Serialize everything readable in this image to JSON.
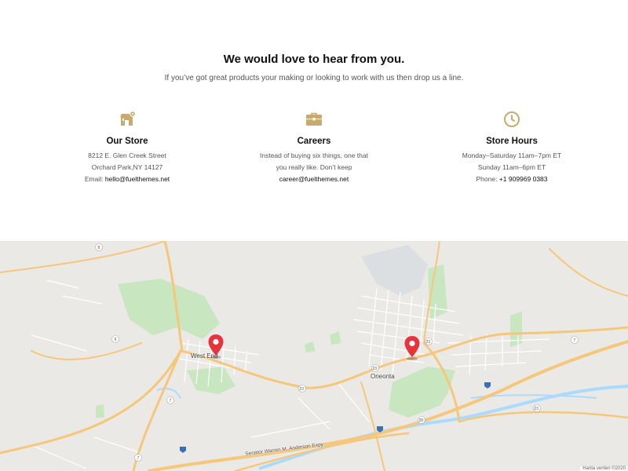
{
  "contact": {
    "heading": "We would love to hear from you.",
    "subheading": "If you’ve got great products your making or looking to work with us then drop us a line.",
    "columns": {
      "store": {
        "icon": "store-icon",
        "title": "Our Store",
        "address_line1": "8212 E. Glen Creek Street",
        "address_line2": "Orchard Park,NY 14127",
        "email_label": "Email:",
        "email": "hello@fuelthemes.net"
      },
      "careers": {
        "icon": "briefcase-icon",
        "title": "Careers",
        "text_line1": "Instead of buying six things, one that",
        "text_line2": "you really like. Don’t keep",
        "email": "career@fuelthemes.net"
      },
      "hours": {
        "icon": "clock-icon",
        "title": "Store Hours",
        "line1": "Monday–Saturday 11am–7pm ET",
        "line2": "Sunday 11am–6pm ET",
        "phone_label": "Phone:",
        "phone": "+1 909969 0383"
      }
    }
  },
  "map": {
    "places": {
      "west_end": "West End",
      "oneonta": "Oneonta"
    },
    "road_name": "Senator Warren M. Anderson Expy",
    "attribution": "Harita verileri ©2020"
  },
  "colors": {
    "accent": "#c9a96e",
    "map_bg": "#ebe9e5",
    "park": "#c8e6c0",
    "highway": "#f5c77a",
    "water": "#aadaff",
    "pin": "#e8323c"
  }
}
